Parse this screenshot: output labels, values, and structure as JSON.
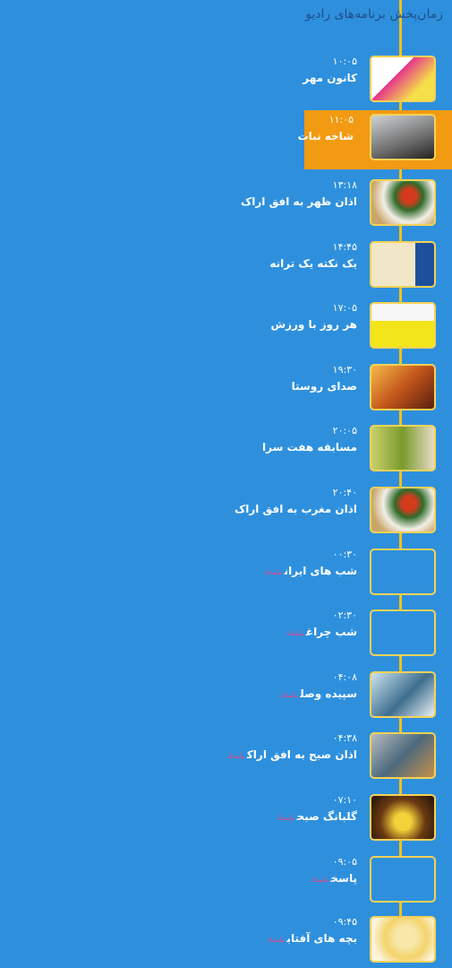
{
  "header": {
    "title": "زمان‌پخش برنامه‌های رادیو"
  },
  "programs": [
    {
      "time": "۱۰:۰۵",
      "title": "کانون مهر",
      "badge": ""
    },
    {
      "time": "۱۱:۰۵",
      "title": "شاخه نبات",
      "badge": ""
    },
    {
      "time": "۱۳:۱۸",
      "title": "اذان ظهر به افق اراک",
      "badge": ""
    },
    {
      "time": "۱۴:۴۵",
      "title": "یک نکته یک ترانه",
      "badge": ""
    },
    {
      "time": "۱۷:۰۵",
      "title": "هر روز با ورزش",
      "badge": ""
    },
    {
      "time": "۱۹:۳۰",
      "title": "صدای روستا",
      "badge": ""
    },
    {
      "time": "۲۰:۰۵",
      "title": "مسابقه هفت سرا",
      "badge": ""
    },
    {
      "time": "۲۰:۴۰",
      "title": "اذان مغرب به افق اراک",
      "badge": ""
    },
    {
      "time": "۰۰:۳۰",
      "title": "شب های ایران",
      "badge": "بامداد"
    },
    {
      "time": "۰۲:۳۰",
      "title": "شب چراغ",
      "badge": "بامداد"
    },
    {
      "time": "۰۴:۰۸",
      "title": "سپیده وصل",
      "badge": "بامداد"
    },
    {
      "time": "۰۴:۳۸",
      "title": "اذان صبح به افق اراک",
      "badge": "بامداد"
    },
    {
      "time": "۰۷:۱۰",
      "title": "گلبانگ صبح",
      "badge": "بامداد"
    },
    {
      "time": "۰۹:۰۵",
      "title": "پاسخ",
      "badge": "بامداد"
    },
    {
      "time": "۰۹:۴۵",
      "title": "بچه های آفتاب",
      "badge": "بامداد"
    }
  ]
}
